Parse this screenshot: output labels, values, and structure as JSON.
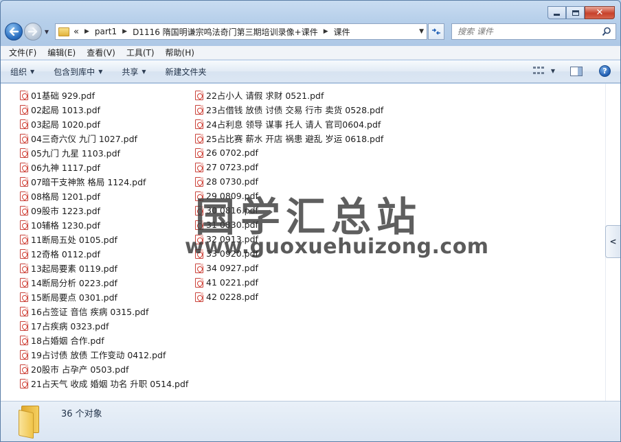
{
  "window": {
    "caption": {
      "minimize": "",
      "maximize": "",
      "close": "✕"
    }
  },
  "nav": {
    "crumb_overflow": "«",
    "breadcrumbs": [
      "part1",
      "D1116 隋国明谦宗鸣法奇门第三期培训录像+课件",
      "课件"
    ]
  },
  "search": {
    "placeholder": "搜索 课件"
  },
  "menu": [
    "文件(F)",
    "编辑(E)",
    "查看(V)",
    "工具(T)",
    "帮助(H)"
  ],
  "toolbar": {
    "organize": "组织",
    "include_library": "包含到库中",
    "share": "共享",
    "new_folder": "新建文件夹"
  },
  "files_col1": [
    "01基础 929.pdf",
    "02起局 1013.pdf",
    "03起局 1020.pdf",
    "04三奇六仪 九门 1027.pdf",
    "05九门 九星 1103.pdf",
    "06九神 1117.pdf",
    "07暗干支神煞 格局 1124.pdf",
    "08格局 1201.pdf",
    "09股市 1223.pdf",
    "10辅格 1230.pdf",
    "11断局五处 0105.pdf",
    "12奇格 0112.pdf",
    "13起局要素 0119.pdf",
    "14断局分析 0223.pdf",
    "15断局要点 0301.pdf",
    "16占签证 音信 疾病 0315.pdf",
    "17占疾病 0323.pdf",
    "18占婚姻 合作.pdf",
    "19占讨债 放债 工作变动 0412.pdf",
    "20股市 占孕产 0503.pdf",
    "21占天气 收成 婚姻 功名 升职 0514.pdf"
  ],
  "files_col2": [
    "22占小人 请假 求财 0521.pdf",
    "23占借钱 放债 讨债 交易 行市 卖货 0528.pdf",
    "24占利息 领导 谋事 托人 请人 官司0604.pdf",
    "25占比赛 薪水 开店 祸患 避乱 岁运 0618.pdf",
    "26 0702.pdf",
    "27 0723.pdf",
    "28 0730.pdf",
    "29 0809.pdf",
    "30 0816.pdf",
    "31 0830.pdf",
    "32 0913.pdf",
    "33 0920.pdf",
    "34 0927.pdf",
    "41 0221.pdf",
    "42 0228.pdf"
  ],
  "watermark": {
    "cn": "国学汇总站",
    "url": "www.guoxuehuizong.com"
  },
  "status": {
    "count": "36 个对象"
  }
}
